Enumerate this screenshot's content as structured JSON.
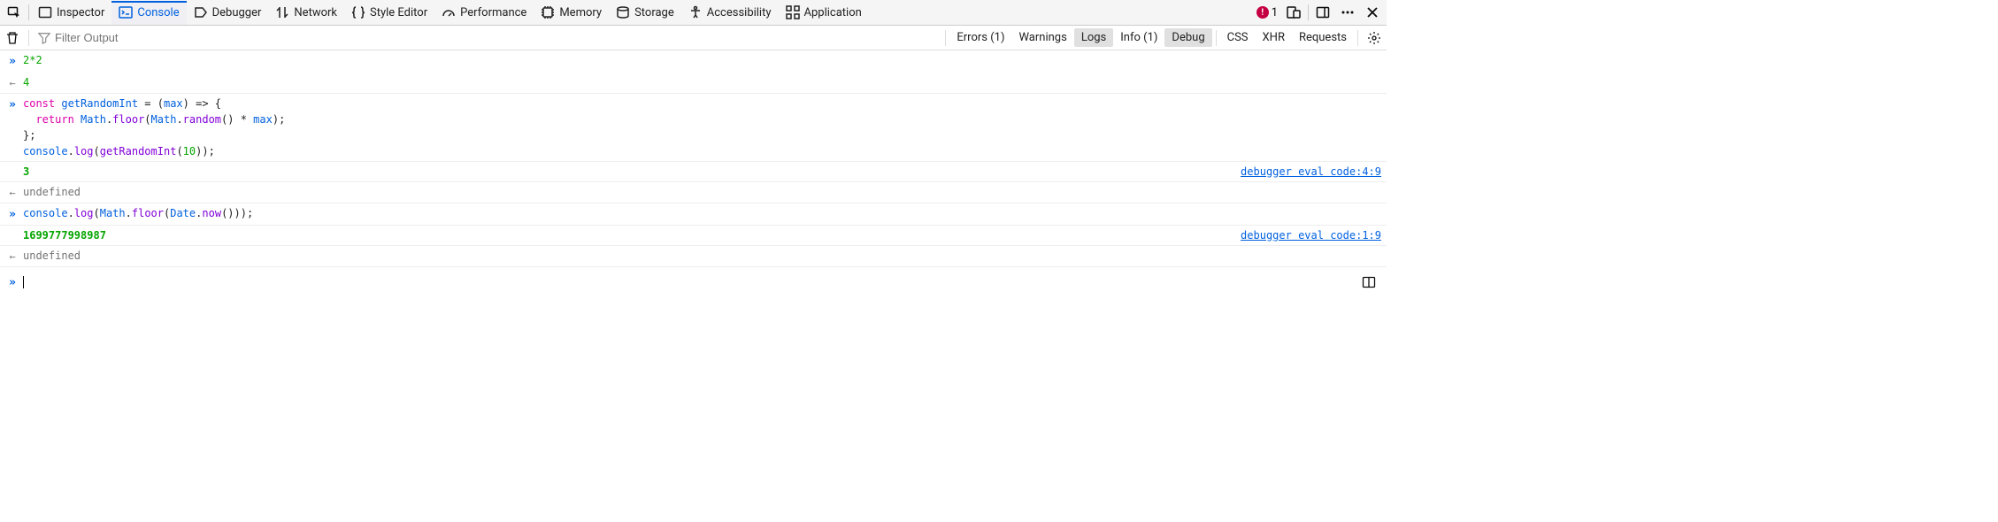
{
  "tabs": {
    "inspector": "Inspector",
    "console": "Console",
    "debugger": "Debugger",
    "network": "Network",
    "style_editor": "Style Editor",
    "performance": "Performance",
    "memory": "Memory",
    "storage": "Storage",
    "accessibility": "Accessibility",
    "application": "Application"
  },
  "error_count": "1",
  "filter": {
    "placeholder": "Filter Output",
    "errors": "Errors (1)",
    "warnings": "Warnings",
    "logs": "Logs",
    "info": "Info (1)",
    "debug": "Debug",
    "css": "CSS",
    "xhr": "XHR",
    "requests": "Requests"
  },
  "entries": {
    "e1_input": "2*2",
    "e1_output": "4",
    "e2_input_l1_kw": "const ",
    "e2_input_l1_name": "getRandomInt",
    "e2_input_l1_eq": " = (",
    "e2_input_l1_arg": "max",
    "e2_input_l1_end": ") => {",
    "e2_input_l2_ret": "  return ",
    "e2_input_l2_math": "Math",
    "e2_input_l2_dot1": ".",
    "e2_input_l2_floor": "floor",
    "e2_input_l2_p1": "(",
    "e2_input_l2_math2": "Math",
    "e2_input_l2_dot2": ".",
    "e2_input_l2_rand": "random",
    "e2_input_l2_p2": "() * ",
    "e2_input_l2_max": "max",
    "e2_input_l2_p3": ");",
    "e2_input_l3": "};",
    "e2_input_l4_a": "console",
    "e2_input_l4_b": ".",
    "e2_input_l4_c": "log",
    "e2_input_l4_d": "(",
    "e2_input_l4_e": "getRandomInt",
    "e2_input_l4_f": "(",
    "e2_input_l4_g": "10",
    "e2_input_l4_h": "));",
    "e2_log": "3",
    "e2_src": "debugger eval code:4:9",
    "e2_output": "undefined",
    "e3_a": "console",
    "e3_b": ".",
    "e3_c": "log",
    "e3_d": "(",
    "e3_math": "Math",
    "e3_dot": ".",
    "e3_floor": "floor",
    "e3_p1": "(",
    "e3_date": "Date",
    "e3_dot2": ".",
    "e3_now": "now",
    "e3_p2": "()));",
    "e3_log": "1699777998987",
    "e3_src": "debugger eval code:1:9",
    "e3_output": "undefined"
  }
}
